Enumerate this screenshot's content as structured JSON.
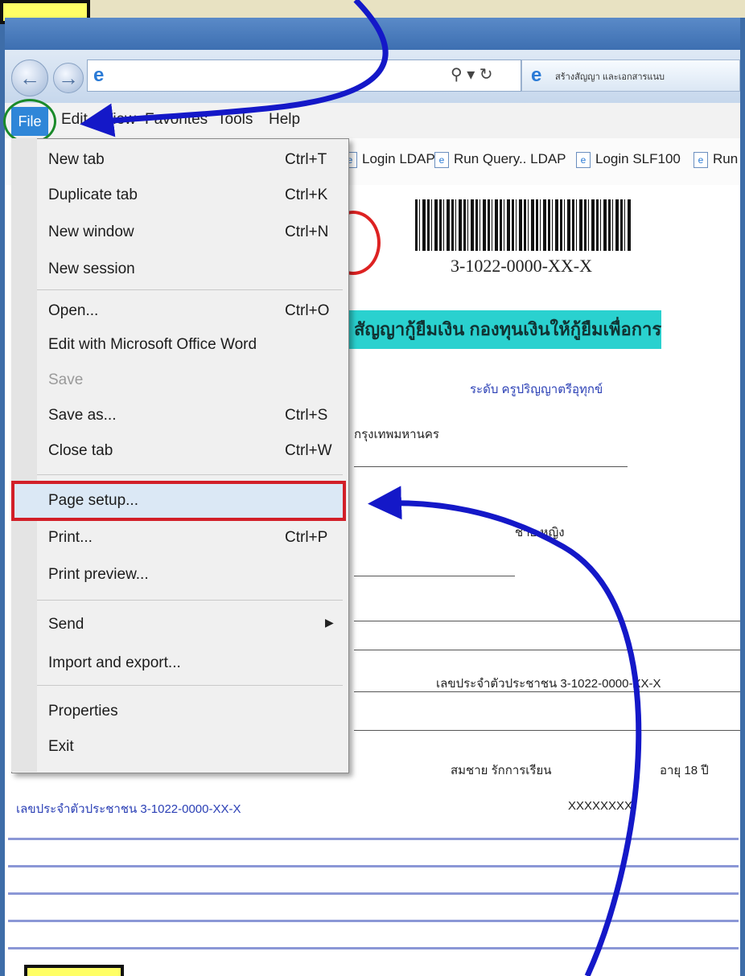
{
  "browser": {
    "tab_title": "สร้างสัญญา และเอกสารแนบ",
    "menubar": [
      "File",
      "Edit",
      "View",
      "Favorites",
      "Tools",
      "Help"
    ],
    "favorites": [
      "Login LDAP",
      "Run Query.. LDAP",
      "Login SLF100",
      "Run"
    ]
  },
  "file_menu": {
    "items": [
      {
        "label": "New tab",
        "shortcut": "Ctrl+T"
      },
      {
        "label": "Duplicate tab",
        "shortcut": "Ctrl+K"
      },
      {
        "label": "New window",
        "shortcut": "Ctrl+N"
      },
      {
        "label": "New session",
        "shortcut": ""
      },
      {
        "label": "Open...",
        "shortcut": "Ctrl+O"
      },
      {
        "label": "Edit with Microsoft Office Word",
        "shortcut": ""
      },
      {
        "label": "Save",
        "shortcut": "",
        "disabled": true
      },
      {
        "label": "Save as...",
        "shortcut": "Ctrl+S"
      },
      {
        "label": "Close tab",
        "shortcut": "Ctrl+W"
      },
      {
        "label": "Page setup...",
        "shortcut": ""
      },
      {
        "label": "Print...",
        "shortcut": "Ctrl+P"
      },
      {
        "label": "Print preview...",
        "shortcut": ""
      },
      {
        "label": "Send",
        "shortcut": ""
      },
      {
        "label": "Import and export...",
        "shortcut": ""
      },
      {
        "label": "Properties",
        "shortcut": ""
      },
      {
        "label": "Exit",
        "shortcut": ""
      }
    ]
  },
  "document": {
    "barcode_number": "3-1022-0000-XX-X",
    "heading": "สัญญากู้ยืมเงิน กองทุนเงินให้กู้ยืมเพื่อการศึกษา",
    "line1": "ระดับ ครูปริญญาตรีอุทุกข์",
    "line2": "กรุงเทพมหานคร",
    "line3": "ชาย  หญิง",
    "line4": "สมชาย รักการเรียน",
    "line5": "อายุ 18 ปี",
    "id_text": "เลขประจำตัวประชาชน 3-1022-0000-XX-X",
    "account": "XXXXXXXX"
  }
}
